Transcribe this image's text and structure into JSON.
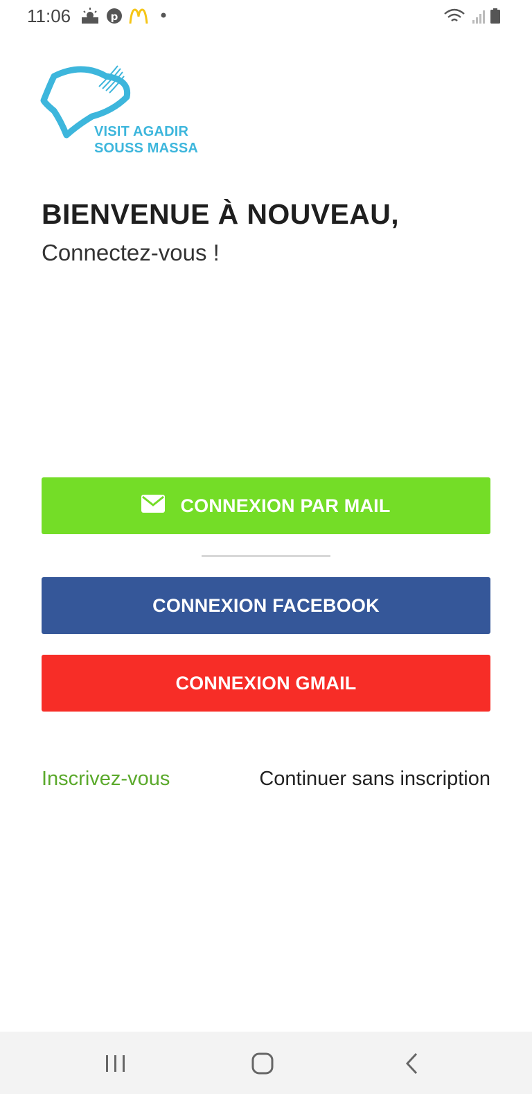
{
  "status_bar": {
    "time": "11:06",
    "left_icons": [
      "weather-sunrise-icon",
      "pinterest-icon",
      "mcdonalds-icon",
      "notification-dot-icon"
    ],
    "right_icons": [
      "wifi-icon",
      "signal-icon",
      "battery-icon"
    ]
  },
  "logo": {
    "line1": "VISIT AGADIR",
    "line2": "SOUSS MASSA",
    "color": "#3db6dc"
  },
  "welcome": {
    "title": "BIENVENUE À NOUVEAU,",
    "subtitle": "Connectez-vous !"
  },
  "buttons": {
    "mail": {
      "label": "CONNEXION PAR MAIL",
      "color": "#74dd27",
      "icon": "mail-icon"
    },
    "facebook": {
      "label": "CONNEXION FACEBOOK",
      "color": "#355799"
    },
    "gmail": {
      "label": "CONNEXION GMAIL",
      "color": "#f72d27"
    }
  },
  "links": {
    "signup": "Inscrivez-vous",
    "guest": "Continuer sans inscription"
  },
  "nav_bar": {
    "icons": [
      "recents-icon",
      "home-icon",
      "back-icon"
    ]
  }
}
